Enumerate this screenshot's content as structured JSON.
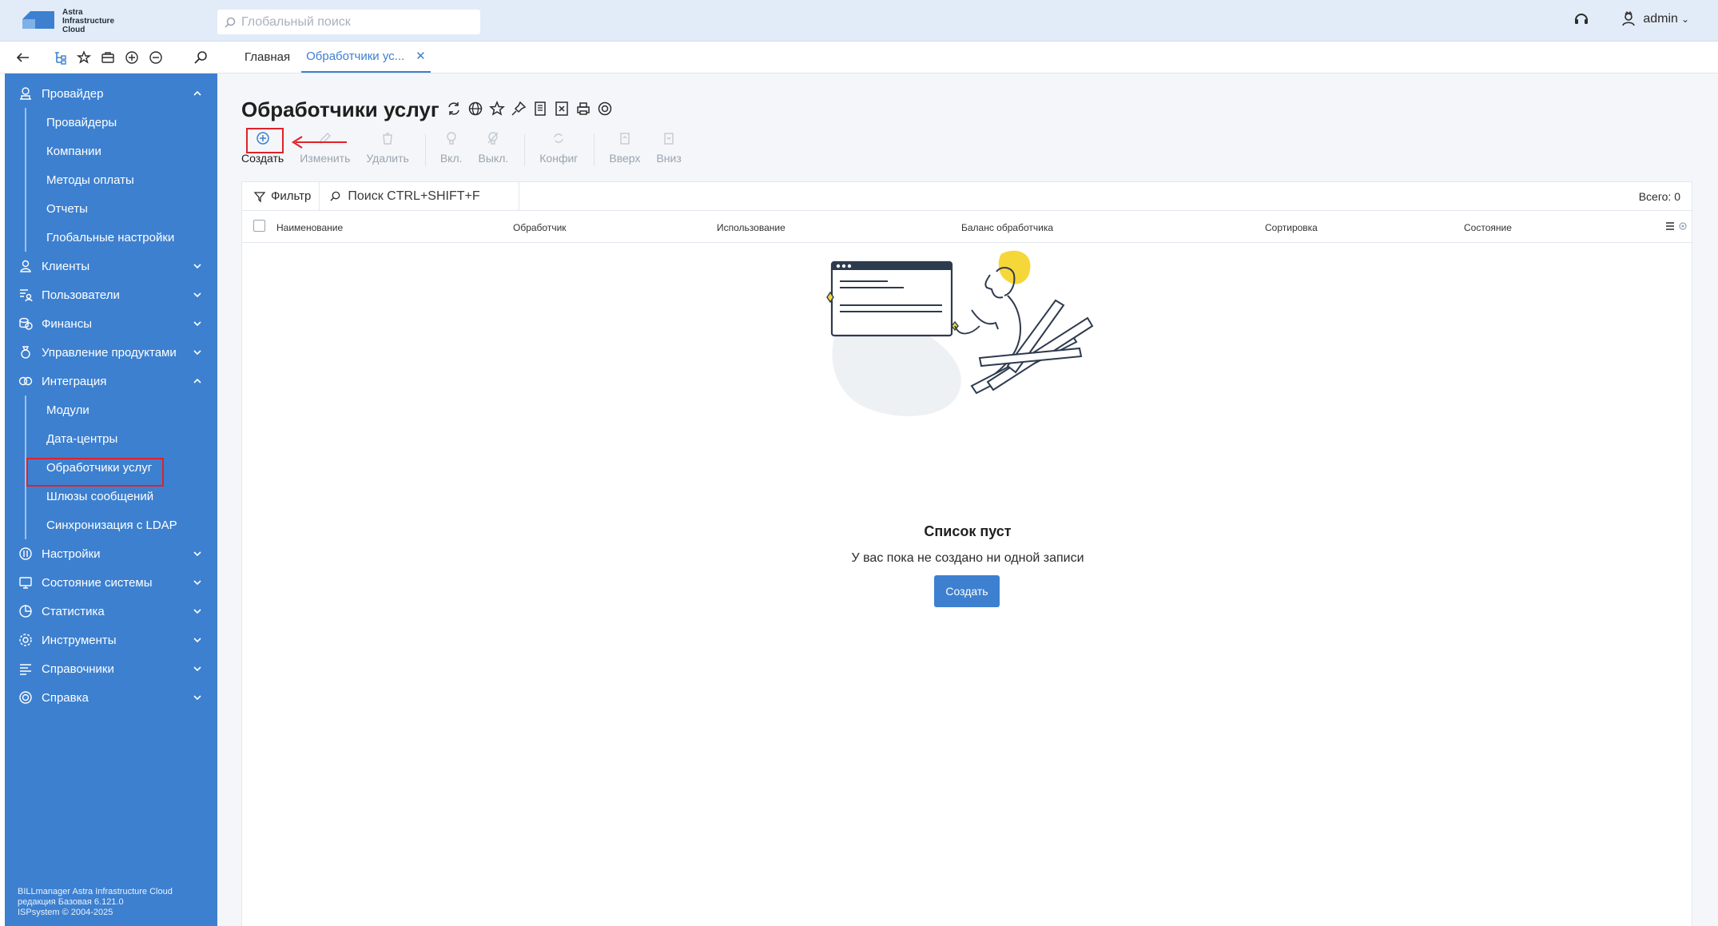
{
  "app": {
    "logo_text_1": "Astra",
    "logo_text_2": "Infrastructure",
    "logo_text_3": "Cloud",
    "search_placeholder": "Глобальный поиск",
    "user_name": "admin"
  },
  "tabs": [
    {
      "label": "Главная"
    },
    {
      "label": "Обработчики ус..."
    }
  ],
  "sidebar": {
    "sections": [
      {
        "label": "Провайдер",
        "icon": "provider-icon",
        "expanded": true
      },
      {
        "label": "Клиенты",
        "icon": "clients-icon",
        "expanded": false
      },
      {
        "label": "Пользователи",
        "icon": "users-icon",
        "expanded": false
      },
      {
        "label": "Финансы",
        "icon": "finance-icon",
        "expanded": false
      },
      {
        "label": "Управление продуктами",
        "icon": "products-icon",
        "expanded": false
      },
      {
        "label": "Интеграция",
        "icon": "integration-icon",
        "expanded": true
      },
      {
        "label": "Настройки",
        "icon": "settings-icon",
        "expanded": false
      },
      {
        "label": "Состояние системы",
        "icon": "monitor-icon",
        "expanded": false
      },
      {
        "label": "Статистика",
        "icon": "stats-icon",
        "expanded": false
      },
      {
        "label": "Инструменты",
        "icon": "tools-icon",
        "expanded": false
      },
      {
        "label": "Справочники",
        "icon": "reference-icon",
        "expanded": false
      },
      {
        "label": "Справка",
        "icon": "help-icon",
        "expanded": false
      }
    ],
    "provider_items": [
      "Провайдеры",
      "Компании",
      "Методы оплаты",
      "Отчеты",
      "Глобальные настройки"
    ],
    "integration_items": [
      "Модули",
      "Дата-центры",
      "Обработчики услуг",
      "Шлюзы сообщений",
      "Синхронизация с LDAP"
    ],
    "footer_line1": "BILLmanager Astra Infrastructure Cloud",
    "footer_line2": "редакция Базовая 6.121.0",
    "footer_line3": "ISPsystem © 2004-2025"
  },
  "page": {
    "title": "Обработчики услуг",
    "actions": [
      {
        "label": "Создать",
        "enabled": true
      },
      {
        "label": "Изменить",
        "enabled": false
      },
      {
        "label": "Удалить",
        "enabled": false
      },
      {
        "label": "Вкл.",
        "enabled": false
      },
      {
        "label": "Выкл.",
        "enabled": false
      },
      {
        "label": "Конфиг",
        "enabled": false
      },
      {
        "label": "Вверх",
        "enabled": false
      },
      {
        "label": "Вниз",
        "enabled": false
      }
    ],
    "filter_label": "Фильтр",
    "search_placeholder": "Поиск CTRL+SHIFT+F",
    "total": "Всего: 0",
    "columns": [
      "Наименование",
      "Обработчик",
      "Использование",
      "Баланс обработчика",
      "Сортировка",
      "Состояние"
    ],
    "empty_title": "Список пуст",
    "empty_subtitle": "У вас пока не создано ни одной записи",
    "empty_button": "Создать"
  },
  "colors": {
    "accent": "#3d80d0",
    "highlight": "#e0222a",
    "illustration_yellow": "#f5d73a"
  }
}
